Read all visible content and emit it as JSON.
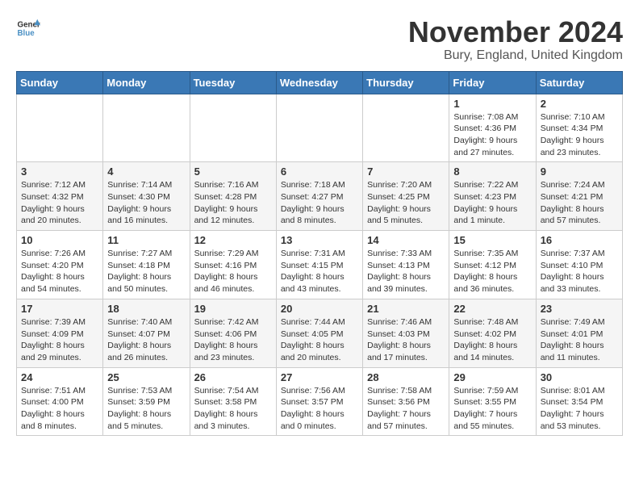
{
  "logo": {
    "line1": "General",
    "line2": "Blue"
  },
  "title": "November 2024",
  "location": "Bury, England, United Kingdom",
  "days_of_week": [
    "Sunday",
    "Monday",
    "Tuesday",
    "Wednesday",
    "Thursday",
    "Friday",
    "Saturday"
  ],
  "weeks": [
    [
      {
        "day": "",
        "info": ""
      },
      {
        "day": "",
        "info": ""
      },
      {
        "day": "",
        "info": ""
      },
      {
        "day": "",
        "info": ""
      },
      {
        "day": "",
        "info": ""
      },
      {
        "day": "1",
        "info": "Sunrise: 7:08 AM\nSunset: 4:36 PM\nDaylight: 9 hours and 27 minutes."
      },
      {
        "day": "2",
        "info": "Sunrise: 7:10 AM\nSunset: 4:34 PM\nDaylight: 9 hours and 23 minutes."
      }
    ],
    [
      {
        "day": "3",
        "info": "Sunrise: 7:12 AM\nSunset: 4:32 PM\nDaylight: 9 hours and 20 minutes."
      },
      {
        "day": "4",
        "info": "Sunrise: 7:14 AM\nSunset: 4:30 PM\nDaylight: 9 hours and 16 minutes."
      },
      {
        "day": "5",
        "info": "Sunrise: 7:16 AM\nSunset: 4:28 PM\nDaylight: 9 hours and 12 minutes."
      },
      {
        "day": "6",
        "info": "Sunrise: 7:18 AM\nSunset: 4:27 PM\nDaylight: 9 hours and 8 minutes."
      },
      {
        "day": "7",
        "info": "Sunrise: 7:20 AM\nSunset: 4:25 PM\nDaylight: 9 hours and 5 minutes."
      },
      {
        "day": "8",
        "info": "Sunrise: 7:22 AM\nSunset: 4:23 PM\nDaylight: 9 hours and 1 minute."
      },
      {
        "day": "9",
        "info": "Sunrise: 7:24 AM\nSunset: 4:21 PM\nDaylight: 8 hours and 57 minutes."
      }
    ],
    [
      {
        "day": "10",
        "info": "Sunrise: 7:26 AM\nSunset: 4:20 PM\nDaylight: 8 hours and 54 minutes."
      },
      {
        "day": "11",
        "info": "Sunrise: 7:27 AM\nSunset: 4:18 PM\nDaylight: 8 hours and 50 minutes."
      },
      {
        "day": "12",
        "info": "Sunrise: 7:29 AM\nSunset: 4:16 PM\nDaylight: 8 hours and 46 minutes."
      },
      {
        "day": "13",
        "info": "Sunrise: 7:31 AM\nSunset: 4:15 PM\nDaylight: 8 hours and 43 minutes."
      },
      {
        "day": "14",
        "info": "Sunrise: 7:33 AM\nSunset: 4:13 PM\nDaylight: 8 hours and 39 minutes."
      },
      {
        "day": "15",
        "info": "Sunrise: 7:35 AM\nSunset: 4:12 PM\nDaylight: 8 hours and 36 minutes."
      },
      {
        "day": "16",
        "info": "Sunrise: 7:37 AM\nSunset: 4:10 PM\nDaylight: 8 hours and 33 minutes."
      }
    ],
    [
      {
        "day": "17",
        "info": "Sunrise: 7:39 AM\nSunset: 4:09 PM\nDaylight: 8 hours and 29 minutes."
      },
      {
        "day": "18",
        "info": "Sunrise: 7:40 AM\nSunset: 4:07 PM\nDaylight: 8 hours and 26 minutes."
      },
      {
        "day": "19",
        "info": "Sunrise: 7:42 AM\nSunset: 4:06 PM\nDaylight: 8 hours and 23 minutes."
      },
      {
        "day": "20",
        "info": "Sunrise: 7:44 AM\nSunset: 4:05 PM\nDaylight: 8 hours and 20 minutes."
      },
      {
        "day": "21",
        "info": "Sunrise: 7:46 AM\nSunset: 4:03 PM\nDaylight: 8 hours and 17 minutes."
      },
      {
        "day": "22",
        "info": "Sunrise: 7:48 AM\nSunset: 4:02 PM\nDaylight: 8 hours and 14 minutes."
      },
      {
        "day": "23",
        "info": "Sunrise: 7:49 AM\nSunset: 4:01 PM\nDaylight: 8 hours and 11 minutes."
      }
    ],
    [
      {
        "day": "24",
        "info": "Sunrise: 7:51 AM\nSunset: 4:00 PM\nDaylight: 8 hours and 8 minutes."
      },
      {
        "day": "25",
        "info": "Sunrise: 7:53 AM\nSunset: 3:59 PM\nDaylight: 8 hours and 5 minutes."
      },
      {
        "day": "26",
        "info": "Sunrise: 7:54 AM\nSunset: 3:58 PM\nDaylight: 8 hours and 3 minutes."
      },
      {
        "day": "27",
        "info": "Sunrise: 7:56 AM\nSunset: 3:57 PM\nDaylight: 8 hours and 0 minutes."
      },
      {
        "day": "28",
        "info": "Sunrise: 7:58 AM\nSunset: 3:56 PM\nDaylight: 7 hours and 57 minutes."
      },
      {
        "day": "29",
        "info": "Sunrise: 7:59 AM\nSunset: 3:55 PM\nDaylight: 7 hours and 55 minutes."
      },
      {
        "day": "30",
        "info": "Sunrise: 8:01 AM\nSunset: 3:54 PM\nDaylight: 7 hours and 53 minutes."
      }
    ]
  ]
}
